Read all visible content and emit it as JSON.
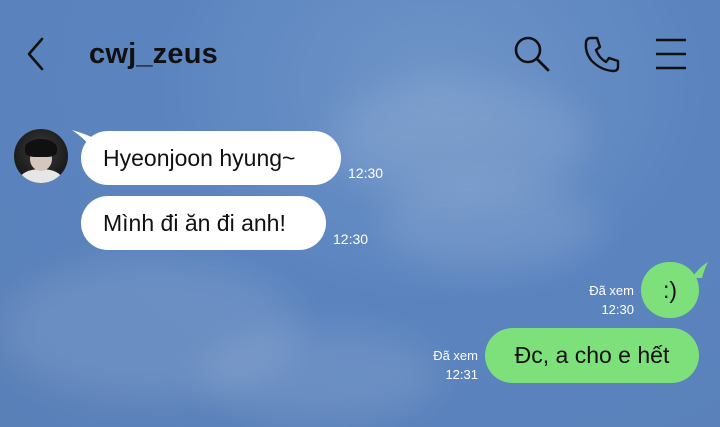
{
  "header": {
    "contact_name": "cwj_zeus",
    "back_icon": "chevron-left-icon",
    "search_icon": "search-icon",
    "call_icon": "phone-icon",
    "menu_icon": "menu-icon"
  },
  "messages": [
    {
      "direction": "incoming",
      "text": "Hyeonjoon hyung~",
      "time": "12:30"
    },
    {
      "direction": "incoming",
      "text": "Mình đi ăn đi anh!",
      "time": "12:30"
    },
    {
      "direction": "outgoing",
      "text": ":)",
      "status": "Đã xem",
      "time": "12:30"
    },
    {
      "direction": "outgoing",
      "text": "Đc, a cho e hết",
      "status": "Đã xem",
      "time": "12:31"
    }
  ],
  "colors": {
    "background": "#5b84bf",
    "incoming_bubble": "#ffffff",
    "outgoing_bubble": "#7ee07a"
  }
}
